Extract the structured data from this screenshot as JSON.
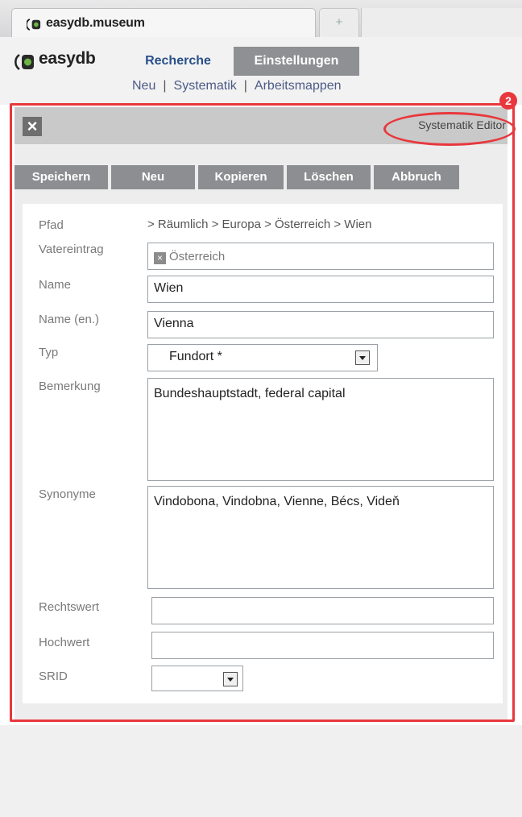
{
  "browser": {
    "tab_title": "easydb.museum",
    "new_tab_symbol": "+"
  },
  "app": {
    "logo_text": "easydb",
    "tabs": [
      {
        "label": "Recherche",
        "active": true
      },
      {
        "label": "Einstellungen",
        "active": false
      }
    ],
    "subnav": [
      "Neu",
      "Systematik",
      "Arbeitsmappen"
    ],
    "subnav_separator": "|"
  },
  "panel": {
    "close_symbol": "×",
    "title": "Systematik Editor",
    "badge": "2",
    "buttons": [
      "Speichern",
      "Neu",
      "Kopieren",
      "Löschen",
      "Abbruch"
    ]
  },
  "form": {
    "pfad": {
      "label": "Pfad",
      "value": "> Räumlich > Europa > Österreich > Wien"
    },
    "vatereintrag": {
      "label": "Vatereintrag",
      "value": "Österreich"
    },
    "name": {
      "label": "Name",
      "value": "Wien"
    },
    "name_en": {
      "label": "Name (en.)",
      "value": "Vienna"
    },
    "typ": {
      "label": "Typ",
      "value": "Fundort *"
    },
    "bemerkung": {
      "label": "Bemerkung",
      "value": "Bundeshauptstadt, federal capital"
    },
    "synonyme": {
      "label": "Synonyme",
      "value": "Vindobona, Vindobna, Vienne, Bécs, Videň"
    },
    "rechtswert": {
      "label": "Rechtswert",
      "value": ""
    },
    "hochwert": {
      "label": "Hochwert",
      "value": ""
    },
    "srid": {
      "label": "SRID",
      "value": ""
    }
  },
  "colors": {
    "highlight": "#e8383d",
    "button_bg": "#8c8e91",
    "link": "#4d5b86"
  }
}
